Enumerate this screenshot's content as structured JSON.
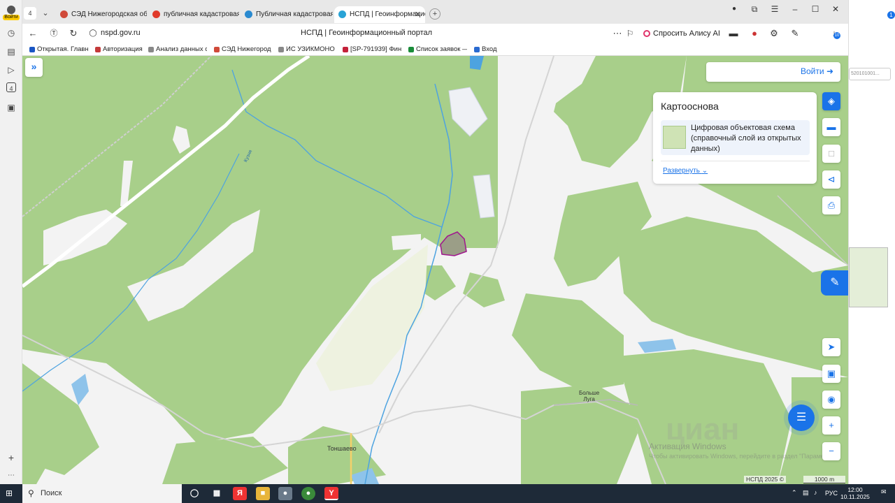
{
  "browser": {
    "rail": {
      "login_label": "Войти",
      "badge_count": "4"
    },
    "tab_count": "4",
    "tabs": [
      {
        "title": "СЭД Нижегородская обл",
        "icon_color": "#d04a3a"
      },
      {
        "title": "публичная кадастровая к",
        "icon_color": "#e03a2a"
      },
      {
        "title": "Публичная кадастровая к",
        "icon_color": "#2a8ad0"
      },
      {
        "title": "НСПД | Геоинформацио",
        "icon_color": "#29a3d6",
        "active": true
      }
    ],
    "address": {
      "url": "nspd.gov.ru",
      "page_title": "НСПД | Геоинформационный портал",
      "alice_label": "Спросить Алису AI",
      "download_badge": "10"
    },
    "bookmarks": [
      {
        "label": "Открытая. Главна",
        "icon_color": "#1a56c4"
      },
      {
        "label": "Авторизация",
        "icon_color": "#c43a3a"
      },
      {
        "label": "Анализ данных об",
        "icon_color": "#888888"
      },
      {
        "label": "СЭД Нижегородс",
        "icon_color": "#d04a3a"
      },
      {
        "label": "ИС УЗИКМОНО 2",
        "icon_color": "#888888"
      },
      {
        "label": "[SP-791939] Фин",
        "icon_color": "#c4213a"
      },
      {
        "label": "Список заявок —",
        "icon_color": "#1a8c3a"
      },
      {
        "label": "Вход",
        "icon_color": "#2a6ad0"
      }
    ]
  },
  "map": {
    "login_label": "Войти",
    "basemap": {
      "title": "Картооснова",
      "item_label": "Цифровая объектовая схема (справочный слой из открытых данных)",
      "expand_link": "Развернуть"
    },
    "places": [
      {
        "name": "Тоншаево"
      },
      {
        "name": "Больше\nЛуга"
      }
    ],
    "river_label": "Кузня",
    "watermark": "циан",
    "activation_title": "Активация Windows",
    "activation_hint": "Чтобы активировать Windows, перейдите в раздел \"Параметры\".",
    "credits": "НСПД 2025 ©",
    "scale": "1000 m",
    "colors": {
      "forest": "#a8cf8a",
      "open_land": "#f3f3f3",
      "river": "#4da3e0",
      "parcel_fill": "#9b9e87",
      "parcel_stroke": "#a0158e",
      "accent": "#1a73e8"
    }
  },
  "right_side": {
    "search_value": "520101001...",
    "badge": "1"
  },
  "taskbar": {
    "search_placeholder": "Поиск",
    "lang": "РУС",
    "time": "12:00",
    "date": "10.11.2025"
  }
}
